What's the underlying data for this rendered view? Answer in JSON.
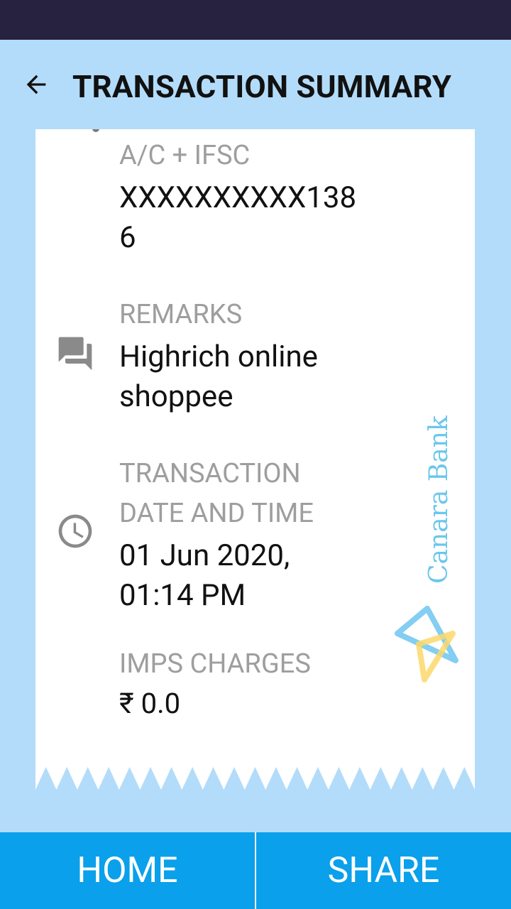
{
  "header": {
    "title": "TRANSACTION SUMMARY"
  },
  "fields": {
    "account": {
      "label": "A/C + IFSC",
      "value_line1": "XXXXXXXXXX138",
      "value_line2": "6"
    },
    "remarks": {
      "label": "REMARKS",
      "value_line1": "Highrich online",
      "value_line2": "shoppee"
    },
    "datetime": {
      "label_line1": "TRANSACTION",
      "label_line2": "DATE AND TIME",
      "value_line1": "01 Jun 2020,",
      "value_line2": "01:14 PM"
    },
    "charges": {
      "label": "IMPS CHARGES",
      "value": "₹ 0.0"
    }
  },
  "watermark": {
    "text": "Canara Bank"
  },
  "bottom": {
    "home_label": "HOME",
    "share_label": "SHARE"
  },
  "colors": {
    "accent": "#0aa0eb",
    "background": "#b3dcfa",
    "statusbar": "#262240"
  },
  "icons": {
    "back": "arrow-left-icon",
    "remarks": "chat-bubbles-icon",
    "datetime": "clock-icon"
  }
}
